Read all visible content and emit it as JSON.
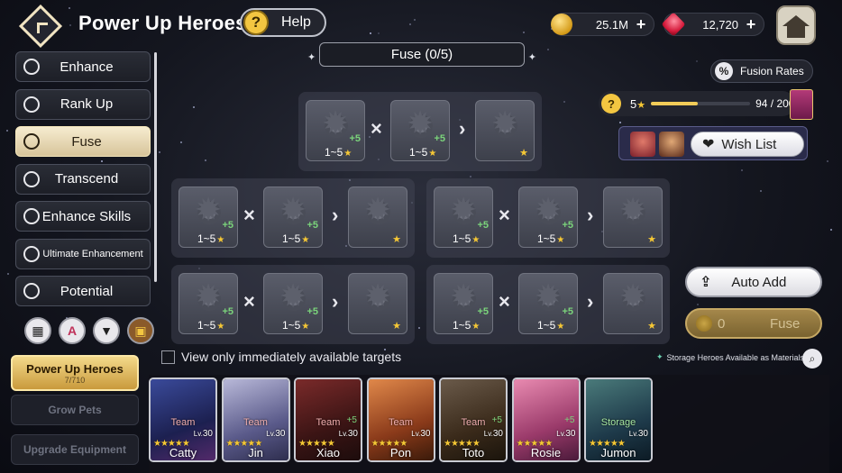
{
  "header": {
    "title": "Power Up Heroes",
    "help_label": "Help"
  },
  "currency": {
    "gold": "25.1M",
    "ruby": "12,720"
  },
  "menu": [
    {
      "label": "Enhance",
      "name": "menu-item-enhance"
    },
    {
      "label": "Rank Up",
      "name": "menu-item-rank-up"
    },
    {
      "label": "Fuse",
      "name": "menu-item-fuse"
    },
    {
      "label": "Transcend",
      "name": "menu-item-transcend"
    },
    {
      "label": "Enhance Skills",
      "name": "menu-item-enhance-skills"
    },
    {
      "label": "Ultimate Enhancement",
      "name": "menu-item-ultimate-enhancement"
    },
    {
      "label": "Potential",
      "name": "menu-item-potential"
    }
  ],
  "active_menu": "Fuse",
  "side_tabs": {
    "power_up": {
      "label": "Power Up Heroes",
      "count": "7/710"
    },
    "grow_pets": "Grow Pets",
    "upgrade_equipment": "Upgrade Equipment"
  },
  "fuse": {
    "header": "Fuse (0/5)",
    "slot_range": "1~5",
    "slot_bonus": "+5",
    "fuse_op": "×",
    "result_op": "›"
  },
  "fusion_rates_label": "Fusion Rates",
  "wish": {
    "level": "5",
    "progress_text": "94 / 200",
    "progress_value": 94,
    "progress_max": 200,
    "wishlist_label": "Wish List"
  },
  "actions": {
    "auto_add": "Auto Add",
    "fuse": "Fuse",
    "fuse_cost": "0"
  },
  "filters": {
    "view_only_label": "View only immediately available targets",
    "storage_note": "Storage Heroes Available as Materials"
  },
  "heroes": [
    {
      "name": "Catty",
      "tag": "Team",
      "level": "30",
      "stars": 5,
      "plus": ""
    },
    {
      "name": "Jin",
      "tag": "Team",
      "level": "30",
      "stars": 5,
      "plus": ""
    },
    {
      "name": "Xiao",
      "tag": "Team",
      "level": "30",
      "stars": 5,
      "plus": "+5"
    },
    {
      "name": "Pon",
      "tag": "Team",
      "level": "30",
      "stars": 5,
      "plus": ""
    },
    {
      "name": "Toto",
      "tag": "Team",
      "level": "30",
      "stars": 5,
      "plus": "+5"
    },
    {
      "name": "Rosie",
      "tag": "",
      "level": "30",
      "stars": 5,
      "plus": "+5"
    },
    {
      "name": "Jumon",
      "tag": "Storage",
      "level": "30",
      "stars": 5,
      "plus": ""
    }
  ],
  "colors": {
    "accent_gold": "#f6c835",
    "active_tab": "#f3d98a",
    "team_tag": "#f2b0b0",
    "storage_tag": "#a6e5a0",
    "bonus_green": "#7bd47b"
  }
}
